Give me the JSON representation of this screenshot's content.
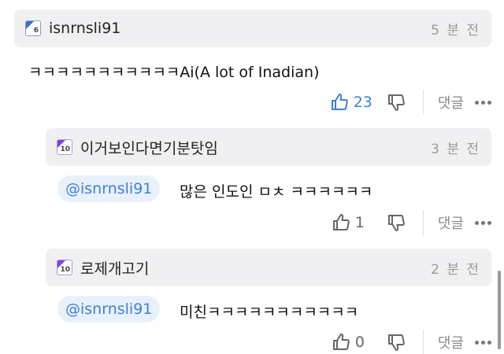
{
  "comments": [
    {
      "badge_level": "6",
      "username": "isnrnsli91",
      "time": "5 분 전",
      "text": "ㅋㅋㅋㅋㅋㅋㅋㅋㅋㅋㅋAi(A lot of Inadian)",
      "likes": "23",
      "like_active": true,
      "reply_label": "댓글"
    },
    {
      "badge_level": "10",
      "username": "이거보인다면기분탓임",
      "time": "3 분 전",
      "mention": "@isnrnsli91",
      "text": "많은 인도인 ㅁㅊ ㅋㅋㅋㅋㅋㅋ",
      "likes": "1",
      "like_active": false,
      "reply_label": "댓글"
    },
    {
      "badge_level": "10",
      "username": "로제개고기",
      "time": "2 분 전",
      "mention": "@isnrnsli91",
      "text": "미친ㅋㅋㅋㅋㅋㅋㅋㅋㅋㅋㅋ",
      "likes": "0",
      "like_active": false,
      "reply_label": "댓글"
    }
  ],
  "colors": {
    "accent_blue": "#3f7fd8",
    "header_bg": "#f0f0f2",
    "mention_bg": "#e8f1fb"
  },
  "icons": [
    "level-badge-icon",
    "thumbs-up-icon",
    "thumbs-down-icon",
    "more-icon"
  ]
}
